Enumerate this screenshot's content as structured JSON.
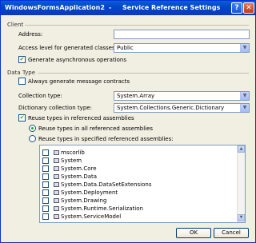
{
  "titlebar": {
    "app": "WindowsFormsApplication2",
    "separator": "-",
    "dialog": "Service Reference Settings",
    "help_glyph": "?",
    "close_glyph": "✕"
  },
  "client": {
    "group_label": "Client",
    "address_label": "Address:",
    "address_value": "",
    "access_label": "Access level for generated classes:",
    "access_value": "Public",
    "async_label": "Generate asynchronous operations",
    "async_checked": true
  },
  "datatype": {
    "group_label": "Data Type",
    "always_label": "Always generate message contracts",
    "always_checked": false,
    "collection_label": "Collection type:",
    "collection_value": "System.Array",
    "dictionary_label": "Dictionary collection type:",
    "dictionary_value": "System.Collections.Generic.Dictionary",
    "reuse_label": "Reuse types in referenced assemblies",
    "reuse_checked": true,
    "reuse_all_label": "Reuse types in all referenced assemblies",
    "reuse_specified_label": "Reuse types in specified referenced assemblies:",
    "reuse_selected": "all"
  },
  "assemblies": [
    {
      "name": "mscorlib",
      "checked": false
    },
    {
      "name": "System",
      "checked": false
    },
    {
      "name": "System.Core",
      "checked": false
    },
    {
      "name": "System.Data",
      "checked": false
    },
    {
      "name": "System.Data.DataSetExtensions",
      "checked": false
    },
    {
      "name": "System.Deployment",
      "checked": false
    },
    {
      "name": "System.Drawing",
      "checked": false
    },
    {
      "name": "System.Runtime.Serialization",
      "checked": false
    },
    {
      "name": "System.ServiceModel",
      "checked": false
    }
  ],
  "buttons": {
    "ok": "OK",
    "cancel": "Cancel"
  },
  "icons": {
    "assembly": "assembly-icon",
    "dropdown": "chevron-down-icon"
  }
}
